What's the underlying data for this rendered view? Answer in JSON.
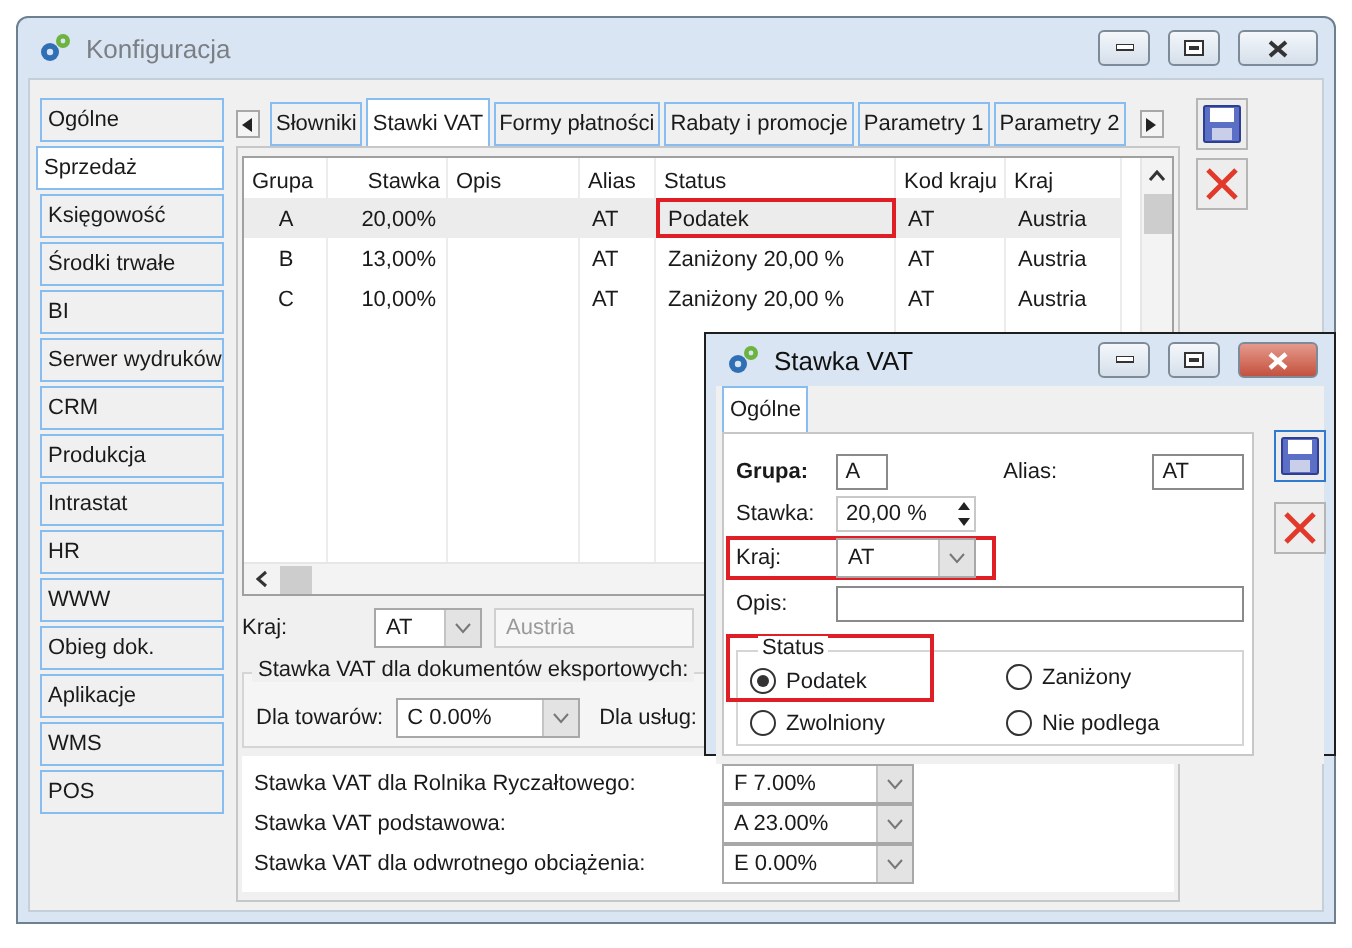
{
  "window": {
    "title": "Konfiguracja"
  },
  "sidebar": {
    "items": [
      {
        "label": "Ogólne",
        "selected": false
      },
      {
        "label": "Sprzedaż",
        "selected": true
      },
      {
        "label": "Księgowość",
        "selected": false
      },
      {
        "label": "Środki trwałe",
        "selected": false
      },
      {
        "label": "BI",
        "selected": false
      },
      {
        "label": "Serwer wydruków",
        "selected": false
      },
      {
        "label": "CRM",
        "selected": false
      },
      {
        "label": "Produkcja",
        "selected": false
      },
      {
        "label": "Intrastat",
        "selected": false
      },
      {
        "label": "HR",
        "selected": false
      },
      {
        "label": "WWW",
        "selected": false
      },
      {
        "label": "Obieg dok.",
        "selected": false
      },
      {
        "label": "Aplikacje",
        "selected": false
      },
      {
        "label": "WMS",
        "selected": false
      },
      {
        "label": "POS",
        "selected": false
      }
    ]
  },
  "tabs": [
    {
      "label": "Słowniki",
      "selected": false
    },
    {
      "label": "Stawki VAT",
      "selected": true
    },
    {
      "label": "Formy płatności",
      "selected": false
    },
    {
      "label": "Rabaty i promocje",
      "selected": false
    },
    {
      "label": "Parametry 1",
      "selected": false
    },
    {
      "label": "Parametry 2",
      "selected": false
    }
  ],
  "table": {
    "columns": [
      "Grupa",
      "Stawka",
      "Opis",
      "Alias",
      "Status",
      "Kod kraju",
      "Kraj"
    ],
    "rows": [
      {
        "cells": [
          "A",
          "20,00%",
          null,
          "AT",
          "Podatek",
          "AT",
          "Austria"
        ],
        "selected": true,
        "highlighted": true
      },
      {
        "cells": [
          "B",
          "13,00%",
          null,
          "AT",
          "Zaniżony 20,00 %",
          "AT",
          "Austria"
        ],
        "selected": false,
        "highlighted": false
      },
      {
        "cells": [
          "C",
          "10,00%",
          null,
          "AT",
          "Zaniżony 20,00 %",
          "AT",
          "Austria"
        ],
        "selected": false,
        "highlighted": false
      }
    ]
  },
  "kraj": {
    "label": "Kraj:",
    "value": "AT",
    "name": "Austria"
  },
  "export_group": {
    "title": "Stawka VAT dla dokumentów eksportowych:",
    "goods": {
      "label": "Dla towarów:",
      "value": "C 0.00%"
    },
    "services": {
      "label": "Dla usług:"
    }
  },
  "rates": [
    {
      "label": "Stawka VAT dla Rolnika Ryczałtowego:",
      "value": "F 7.00%"
    },
    {
      "label": "Stawka VAT podstawowa:",
      "value": "A 23.00%"
    },
    {
      "label": "Stawka VAT dla odwrotnego obciążenia:",
      "value": "E 0.00%"
    }
  ],
  "dialog": {
    "title": "Stawka VAT",
    "tabs": [
      {
        "label": "Ogólne",
        "selected": true
      }
    ],
    "grupa": {
      "label": "Grupa:",
      "value": "A"
    },
    "alias": {
      "label": "Alias:",
      "value": "AT"
    },
    "stawka": {
      "label": "Stawka:",
      "value": "20,00 %"
    },
    "kraj": {
      "label": "Kraj:",
      "value": "AT",
      "highlighted": true
    },
    "opis": {
      "label": "Opis:"
    },
    "status": {
      "title": "Status",
      "highlighted": true,
      "options": [
        {
          "label": "Podatek",
          "selected": true
        },
        {
          "label": "Zaniżony",
          "selected": false
        },
        {
          "label": "Zwolniony",
          "selected": false
        },
        {
          "label": "Nie podlega",
          "selected": false
        }
      ]
    }
  }
}
